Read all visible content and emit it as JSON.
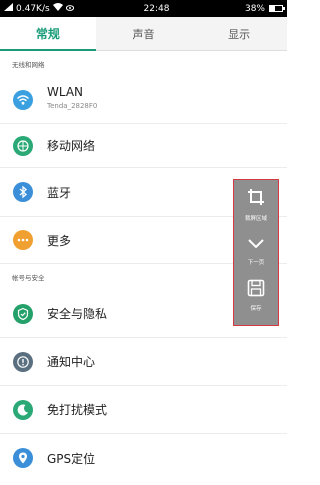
{
  "status_bar": {
    "signal": "0.47K/s",
    "time": "22:48",
    "battery": "38%",
    "battery_level": 0.38
  },
  "tabs": [
    {
      "label": "常规",
      "active": true
    },
    {
      "label": "声音",
      "active": false
    },
    {
      "label": "显示",
      "active": false
    }
  ],
  "sections": {
    "network_header": "无线和网络",
    "account_header": "帐号与安全"
  },
  "items": {
    "wlan": {
      "label": "WLAN",
      "sub": "Tenda_2828F0",
      "icon": "wifi-icon",
      "color": "#3aa0e0"
    },
    "mobile": {
      "label": "移动网络",
      "icon": "globe-icon",
      "color": "#2aa876"
    },
    "bluetooth": {
      "label": "蓝牙",
      "icon": "bluetooth-icon",
      "color": "#3b8fd9"
    },
    "more": {
      "label": "更多",
      "icon": "more-dots-icon",
      "color": "#f0a030"
    },
    "security": {
      "label": "安全与隐私",
      "icon": "shield-icon",
      "color": "#24a06a"
    },
    "notification": {
      "label": "通知中心",
      "icon": "alert-icon",
      "color": "#5a6f80"
    },
    "dnd": {
      "label": "免打扰模式",
      "icon": "moon-icon",
      "color": "#2aa876"
    },
    "gps": {
      "label": "GPS定位",
      "icon": "location-icon",
      "color": "#3b8fd9"
    }
  },
  "toolbar": {
    "crop_label": "裁屏区域",
    "next_label": "下一页",
    "save_label": "保存"
  }
}
